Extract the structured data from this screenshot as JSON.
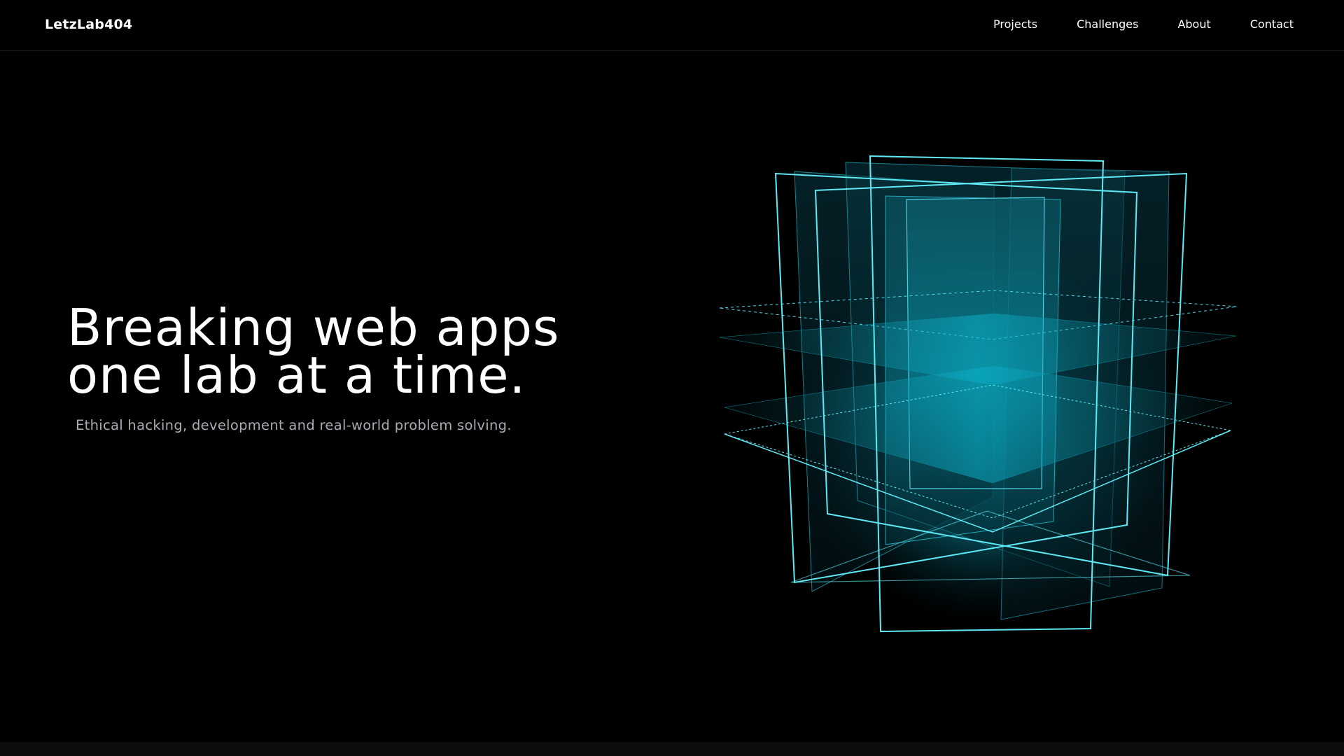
{
  "nav": {
    "brand": "LetzLab404",
    "links": [
      {
        "label": "Projects"
      },
      {
        "label": "Challenges"
      },
      {
        "label": "About"
      },
      {
        "label": "Contact"
      }
    ]
  },
  "hero": {
    "title_line1": "Breaking web apps",
    "title_line2": "one lab at a time.",
    "subtitle": "Ethical hacking, development and real-world problem solving."
  },
  "colors": {
    "background": "#000000",
    "accent": "#5ee9f4",
    "subtitle_text": "#a9adb3"
  }
}
